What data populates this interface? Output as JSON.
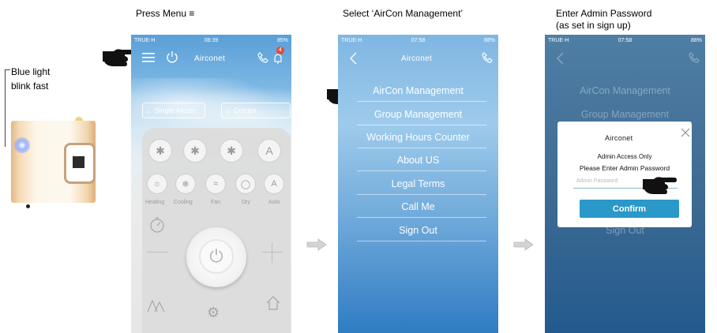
{
  "captions": {
    "step1": "Press Menu ≡",
    "step2": "Select ‘AirCon Management’",
    "step3_line1": "Enter Admin Password",
    "step3_line2": "(as set in sign up)"
  },
  "device_note": {
    "line1": "Blue light",
    "line2": "blink fast"
  },
  "phone1": {
    "status": {
      "carrier": "TRUE-H",
      "time": "08:39",
      "battery": "85%"
    },
    "logo": "Airconet",
    "notification_count": "4",
    "dropdowns": {
      "single": "Single Aircon",
      "groups": "Groups"
    },
    "modes": [
      {
        "label": "Heating"
      },
      {
        "label": "Cooling"
      },
      {
        "label": "Fan"
      },
      {
        "label": "Dry"
      },
      {
        "label": "Auto"
      }
    ],
    "fan_auto": "A",
    "mode_auto_glyph": "A"
  },
  "phone2": {
    "status": {
      "carrier": "TRUE-H",
      "time": "07:58",
      "battery": "88%"
    },
    "logo": "Airconet",
    "menu": [
      "AirCon Management",
      "Group Management",
      "Working Hours Counter",
      "About US",
      "Legal Terms",
      "Call Me",
      "Sign Out"
    ]
  },
  "phone3": {
    "status": {
      "carrier": "TRUE-H",
      "time": "07:58",
      "battery": "88%"
    },
    "bg_menu": [
      "AirCon Management",
      "Group Management"
    ],
    "bg_signout": "Sign Out",
    "dialog": {
      "logo": "Airconet",
      "line1": "Admin Access Only",
      "line2": "Please Enter Admin Password",
      "placeholder": "Admin Password",
      "confirm": "Confirm"
    }
  },
  "colors": {
    "menu_bg": "#2f7cc3",
    "confirm": "#2a98c8",
    "led": "#9ab4ff"
  }
}
